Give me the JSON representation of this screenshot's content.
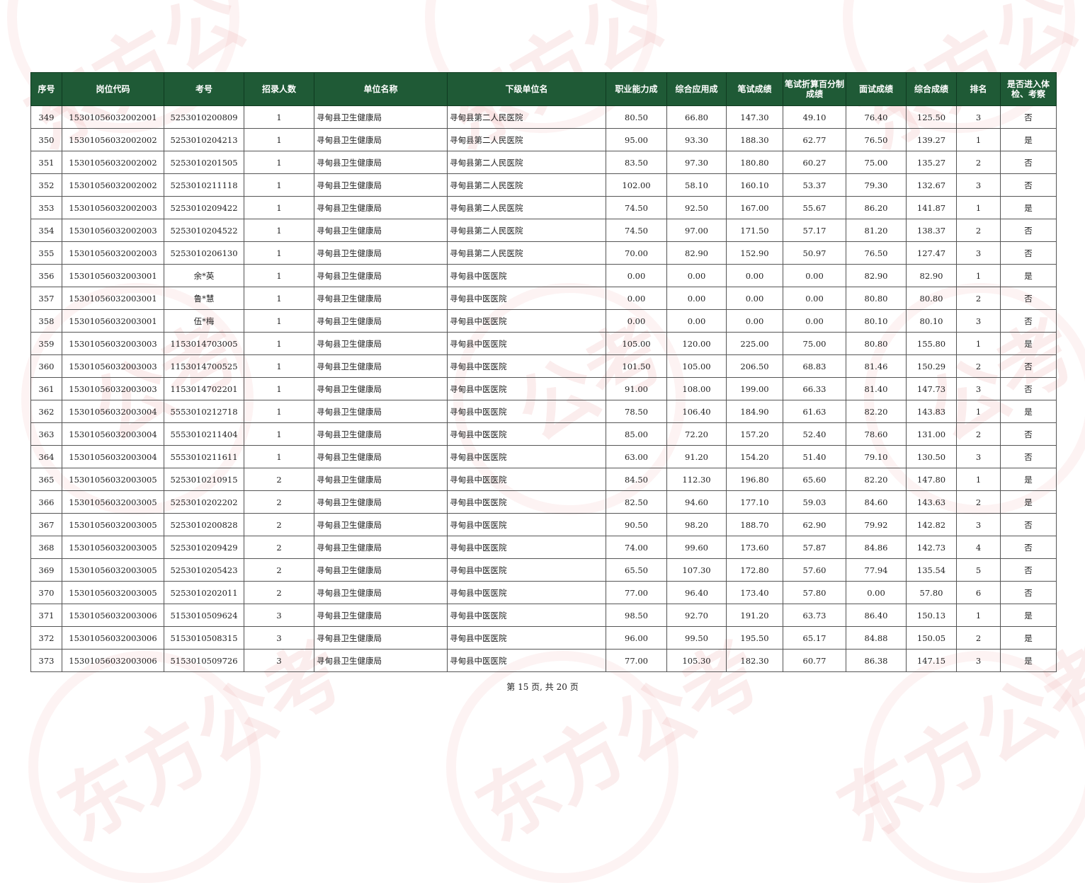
{
  "watermark_text": [
    "东方公",
    "东方公",
    "东方公",
    "公考",
    "公考",
    "公考",
    "东方公考",
    "东方公考",
    "东方公考"
  ],
  "columns": [
    "序号",
    "岗位代码",
    "考号",
    "招录人数",
    "单位名称",
    "下级单位名",
    "职业能力成",
    "综合应用成",
    "笔试成绩",
    "笔试折算百分制成绩",
    "面试成绩",
    "综合成绩",
    "排名",
    "是否进入体检、考察"
  ],
  "rows": [
    [
      "349",
      "15301056032002001",
      "5253010200809",
      "1",
      "寻甸县卫生健康局",
      "寻甸县第二人民医院",
      "80.50",
      "66.80",
      "147.30",
      "49.10",
      "76.40",
      "125.50",
      "3",
      "否"
    ],
    [
      "350",
      "15301056032002002",
      "5253010204213",
      "1",
      "寻甸县卫生健康局",
      "寻甸县第二人民医院",
      "95.00",
      "93.30",
      "188.30",
      "62.77",
      "76.50",
      "139.27",
      "1",
      "是"
    ],
    [
      "351",
      "15301056032002002",
      "5253010201505",
      "1",
      "寻甸县卫生健康局",
      "寻甸县第二人民医院",
      "83.50",
      "97.30",
      "180.80",
      "60.27",
      "75.00",
      "135.27",
      "2",
      "否"
    ],
    [
      "352",
      "15301056032002002",
      "5253010211118",
      "1",
      "寻甸县卫生健康局",
      "寻甸县第二人民医院",
      "102.00",
      "58.10",
      "160.10",
      "53.37",
      "79.30",
      "132.67",
      "3",
      "否"
    ],
    [
      "353",
      "15301056032002003",
      "5253010209422",
      "1",
      "寻甸县卫生健康局",
      "寻甸县第二人民医院",
      "74.50",
      "92.50",
      "167.00",
      "55.67",
      "86.20",
      "141.87",
      "1",
      "是"
    ],
    [
      "354",
      "15301056032002003",
      "5253010204522",
      "1",
      "寻甸县卫生健康局",
      "寻甸县第二人民医院",
      "74.50",
      "97.00",
      "171.50",
      "57.17",
      "81.20",
      "138.37",
      "2",
      "否"
    ],
    [
      "355",
      "15301056032002003",
      "5253010206130",
      "1",
      "寻甸县卫生健康局",
      "寻甸县第二人民医院",
      "70.00",
      "82.90",
      "152.90",
      "50.97",
      "76.50",
      "127.47",
      "3",
      "否"
    ],
    [
      "356",
      "15301056032003001",
      "余*英",
      "1",
      "寻甸县卫生健康局",
      "寻甸县中医医院",
      "0.00",
      "0.00",
      "0.00",
      "0.00",
      "82.90",
      "82.90",
      "1",
      "是"
    ],
    [
      "357",
      "15301056032003001",
      "鲁*慧",
      "1",
      "寻甸县卫生健康局",
      "寻甸县中医医院",
      "0.00",
      "0.00",
      "0.00",
      "0.00",
      "80.80",
      "80.80",
      "2",
      "否"
    ],
    [
      "358",
      "15301056032003001",
      "伍*梅",
      "1",
      "寻甸县卫生健康局",
      "寻甸县中医医院",
      "0.00",
      "0.00",
      "0.00",
      "0.00",
      "80.10",
      "80.10",
      "3",
      "否"
    ],
    [
      "359",
      "15301056032003003",
      "1153014703005",
      "1",
      "寻甸县卫生健康局",
      "寻甸县中医医院",
      "105.00",
      "120.00",
      "225.00",
      "75.00",
      "80.80",
      "155.80",
      "1",
      "是"
    ],
    [
      "360",
      "15301056032003003",
      "1153014700525",
      "1",
      "寻甸县卫生健康局",
      "寻甸县中医医院",
      "101.50",
      "105.00",
      "206.50",
      "68.83",
      "81.46",
      "150.29",
      "2",
      "否"
    ],
    [
      "361",
      "15301056032003003",
      "1153014702201",
      "1",
      "寻甸县卫生健康局",
      "寻甸县中医医院",
      "91.00",
      "108.00",
      "199.00",
      "66.33",
      "81.40",
      "147.73",
      "3",
      "否"
    ],
    [
      "362",
      "15301056032003004",
      "5553010212718",
      "1",
      "寻甸县卫生健康局",
      "寻甸县中医医院",
      "78.50",
      "106.40",
      "184.90",
      "61.63",
      "82.20",
      "143.83",
      "1",
      "是"
    ],
    [
      "363",
      "15301056032003004",
      "5553010211404",
      "1",
      "寻甸县卫生健康局",
      "寻甸县中医医院",
      "85.00",
      "72.20",
      "157.20",
      "52.40",
      "78.60",
      "131.00",
      "2",
      "否"
    ],
    [
      "364",
      "15301056032003004",
      "5553010211611",
      "1",
      "寻甸县卫生健康局",
      "寻甸县中医医院",
      "63.00",
      "91.20",
      "154.20",
      "51.40",
      "79.10",
      "130.50",
      "3",
      "否"
    ],
    [
      "365",
      "15301056032003005",
      "5253010210915",
      "2",
      "寻甸县卫生健康局",
      "寻甸县中医医院",
      "84.50",
      "112.30",
      "196.80",
      "65.60",
      "82.20",
      "147.80",
      "1",
      "是"
    ],
    [
      "366",
      "15301056032003005",
      "5253010202202",
      "2",
      "寻甸县卫生健康局",
      "寻甸县中医医院",
      "82.50",
      "94.60",
      "177.10",
      "59.03",
      "84.60",
      "143.63",
      "2",
      "是"
    ],
    [
      "367",
      "15301056032003005",
      "5253010200828",
      "2",
      "寻甸县卫生健康局",
      "寻甸县中医医院",
      "90.50",
      "98.20",
      "188.70",
      "62.90",
      "79.92",
      "142.82",
      "3",
      "否"
    ],
    [
      "368",
      "15301056032003005",
      "5253010209429",
      "2",
      "寻甸县卫生健康局",
      "寻甸县中医医院",
      "74.00",
      "99.60",
      "173.60",
      "57.87",
      "84.86",
      "142.73",
      "4",
      "否"
    ],
    [
      "369",
      "15301056032003005",
      "5253010205423",
      "2",
      "寻甸县卫生健康局",
      "寻甸县中医医院",
      "65.50",
      "107.30",
      "172.80",
      "57.60",
      "77.94",
      "135.54",
      "5",
      "否"
    ],
    [
      "370",
      "15301056032003005",
      "5253010202011",
      "2",
      "寻甸县卫生健康局",
      "寻甸县中医医院",
      "77.00",
      "96.40",
      "173.40",
      "57.80",
      "0.00",
      "57.80",
      "6",
      "否"
    ],
    [
      "371",
      "15301056032003006",
      "5153010509624",
      "3",
      "寻甸县卫生健康局",
      "寻甸县中医医院",
      "98.50",
      "92.70",
      "191.20",
      "63.73",
      "86.40",
      "150.13",
      "1",
      "是"
    ],
    [
      "372",
      "15301056032003006",
      "5153010508315",
      "3",
      "寻甸县卫生健康局",
      "寻甸县中医医院",
      "96.00",
      "99.50",
      "195.50",
      "65.17",
      "84.88",
      "150.05",
      "2",
      "是"
    ],
    [
      "373",
      "15301056032003006",
      "5153010509726",
      "3",
      "寻甸县卫生健康局",
      "寻甸县中医医院",
      "77.00",
      "105.30",
      "182.30",
      "60.77",
      "86.38",
      "147.15",
      "3",
      "是"
    ]
  ],
  "footer": "第 15 页, 共 20 页",
  "colors": {
    "header_bg": "#1f5a36",
    "header_text": "#ffffff",
    "watermark": "#e88c8c"
  }
}
